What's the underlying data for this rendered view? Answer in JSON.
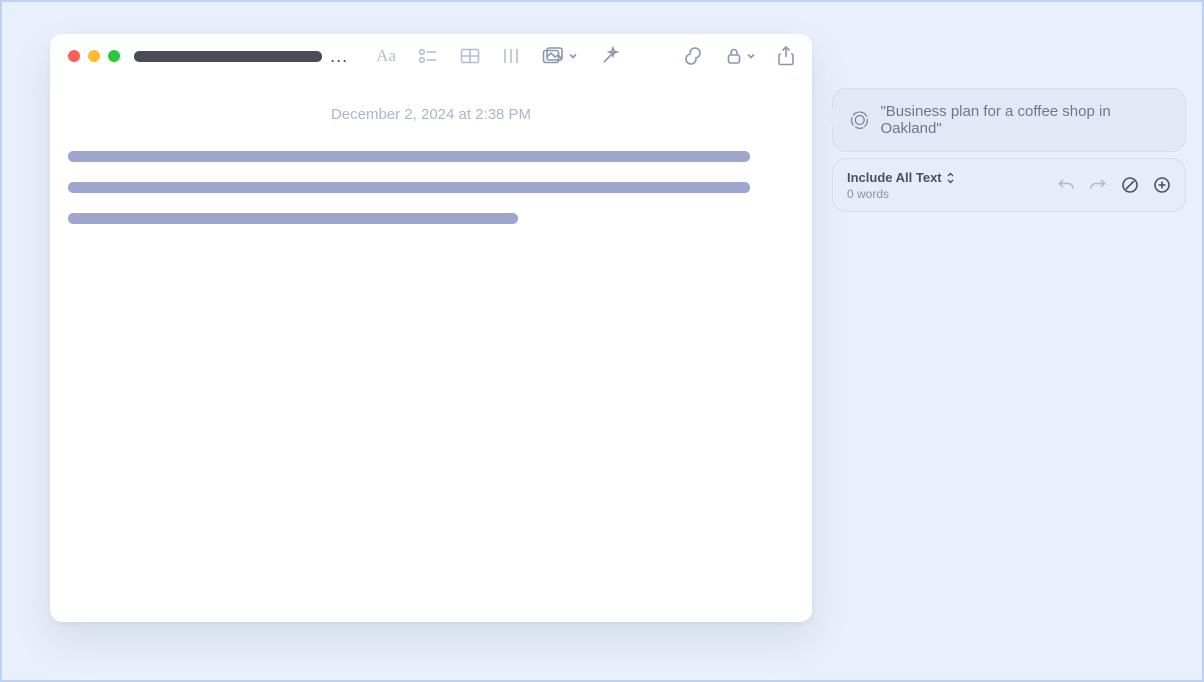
{
  "note": {
    "timestamp": "December 2, 2024 at 2:38 PM"
  },
  "toolbar": {
    "icons": {
      "format": "Aa",
      "checklist": "checklist-icon",
      "table": "table-icon",
      "align": "align-icon",
      "media": "media-icon",
      "wand": "wand-icon",
      "link": "link-icon",
      "lock": "lock-icon",
      "share": "share-icon"
    }
  },
  "assistant": {
    "prompt": "\"Business plan for a coffee shop in Oakland\"",
    "include_label": "Include All Text",
    "word_count_label": "0 words"
  }
}
